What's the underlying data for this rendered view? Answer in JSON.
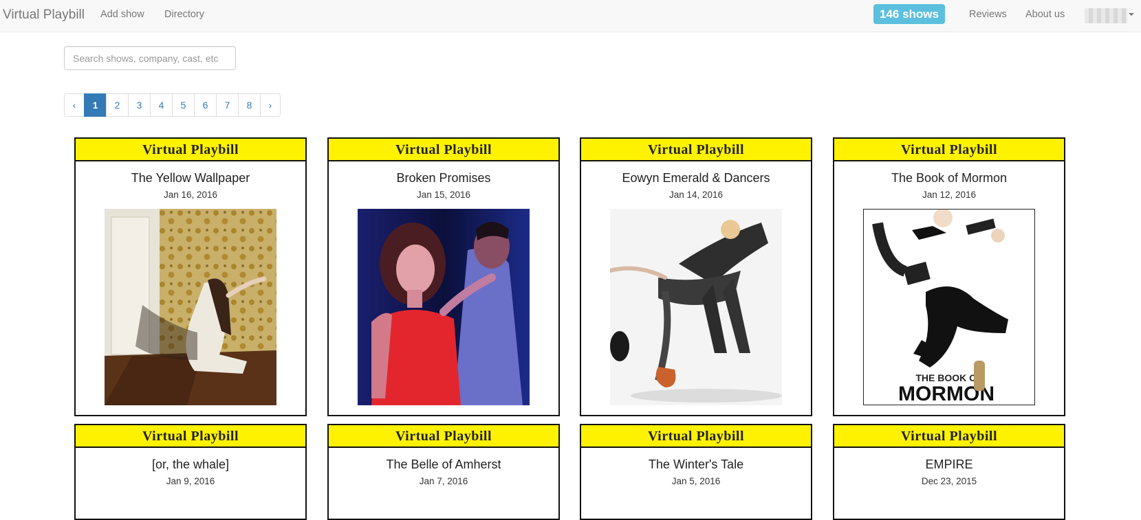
{
  "navbar": {
    "brand": "Virtual Playbill",
    "links": [
      "Add show",
      "Directory"
    ],
    "badge": "146 shows",
    "right_links": [
      "Reviews",
      "About us"
    ]
  },
  "search": {
    "placeholder": "Search shows, company, cast, etc"
  },
  "pagination": {
    "prev": "‹",
    "pages": [
      "1",
      "2",
      "3",
      "4",
      "5",
      "6",
      "7",
      "8"
    ],
    "next": "›",
    "active": "1"
  },
  "card_header": "Virtual Playbill",
  "shows": [
    {
      "title": "The Yellow Wallpaper",
      "date": "Jan 16, 2016"
    },
    {
      "title": "Broken Promises",
      "date": "Jan 15, 2016"
    },
    {
      "title": "Eowyn Emerald & Dancers",
      "date": "Jan 14, 2016"
    },
    {
      "title": "The Book of Mormon",
      "date": "Jan 12, 2016",
      "poster_text": [
        "THE BOOK OF",
        "MORMON"
      ]
    },
    {
      "title": "[or, the whale]",
      "date": "Jan 9, 2016"
    },
    {
      "title": "The Belle of Amherst",
      "date": "Jan 7, 2016"
    },
    {
      "title": "The Winter's Tale",
      "date": "Jan 5, 2016"
    },
    {
      "title": "EMPIRE",
      "date": "Dec 23, 2015"
    }
  ],
  "colors": {
    "header_yellow": "#fff200",
    "badge": "#5bc0de",
    "link": "#337ab7"
  }
}
